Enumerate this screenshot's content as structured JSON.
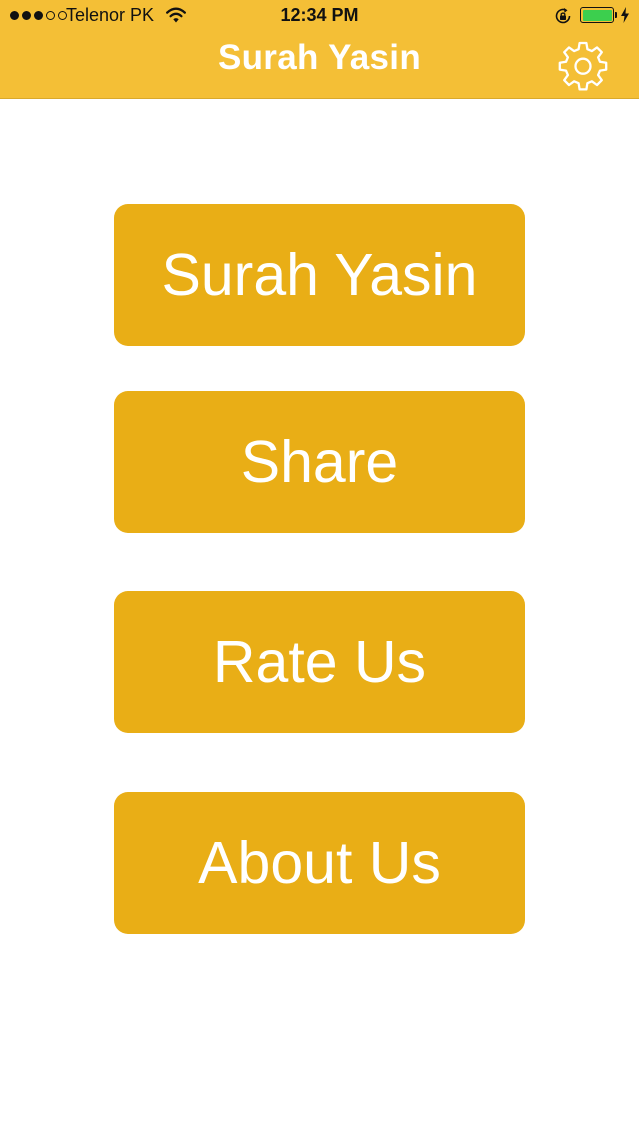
{
  "status_bar": {
    "signal_bars_filled": 3,
    "signal_bars_total": 5,
    "carrier": "Telenor PK",
    "time": "12:34 PM",
    "battery_level": 1.0,
    "charging": true
  },
  "nav": {
    "title": "Surah Yasin",
    "settings_icon": "gear-icon"
  },
  "menu": {
    "buttons": [
      {
        "label": "Surah Yasin"
      },
      {
        "label": "Share"
      },
      {
        "label": "Rate Us"
      },
      {
        "label": "About Us"
      }
    ]
  },
  "colors": {
    "nav_bar": "#F4BF36",
    "button": "#E9AE16",
    "button_text": "#FFFFFF",
    "background": "#FFFFFF"
  }
}
